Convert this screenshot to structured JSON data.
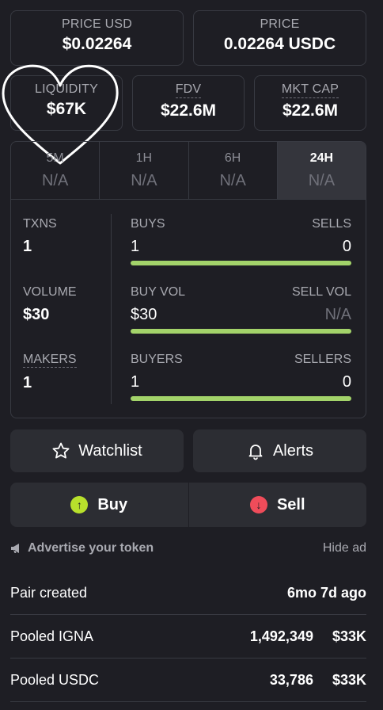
{
  "cards": {
    "price_usd": {
      "label": "PRICE USD",
      "value": "$0.02264"
    },
    "price": {
      "label": "PRICE",
      "value": "0.02264 USDC"
    },
    "liquidity": {
      "label": "LIQUIDITY",
      "value": "$67K"
    },
    "fdv": {
      "label": "FDV",
      "value": "$22.6M"
    },
    "mkt_cap": {
      "label": "MKT CAP",
      "value": "$22.6M"
    }
  },
  "timeframes": [
    {
      "label": "5M",
      "value": "N/A"
    },
    {
      "label": "1H",
      "value": "N/A"
    },
    {
      "label": "6H",
      "value": "N/A"
    },
    {
      "label": "24H",
      "value": "N/A"
    }
  ],
  "stats": {
    "txns": {
      "label": "TXNS",
      "value": "1"
    },
    "volume": {
      "label": "VOLUME",
      "value": "$30"
    },
    "makers": {
      "label": "MAKERS",
      "value": "1"
    },
    "buys": {
      "left_label": "BUYS",
      "right_label": "SELLS",
      "left_value": "1",
      "right_value": "0",
      "buy_fraction": 1.0
    },
    "buy_vol": {
      "left_label": "BUY VOL",
      "right_label": "SELL VOL",
      "left_value": "$30",
      "right_value": "N/A",
      "buy_fraction": 1.0
    },
    "buyers": {
      "left_label": "BUYERS",
      "right_label": "SELLERS",
      "left_value": "1",
      "right_value": "0",
      "buy_fraction": 1.0
    }
  },
  "actions": {
    "watchlist": "Watchlist",
    "alerts": "Alerts",
    "buy": "Buy",
    "sell": "Sell"
  },
  "advertise": {
    "label": "Advertise your token",
    "hide": "Hide ad"
  },
  "info_rows": {
    "pair_created": {
      "label": "Pair created",
      "value": "6mo 7d ago"
    },
    "pooled_igna": {
      "label": "Pooled IGNA",
      "amount": "1,492,349",
      "usd": "$33K"
    },
    "pooled_usdc": {
      "label": "Pooled USDC",
      "amount": "33,786",
      "usd": "$33K"
    }
  },
  "colors": {
    "bar": "#a3d36a",
    "buy": "#b8e02c",
    "sell": "#ef4c5a",
    "bg": "#1e1e24"
  }
}
